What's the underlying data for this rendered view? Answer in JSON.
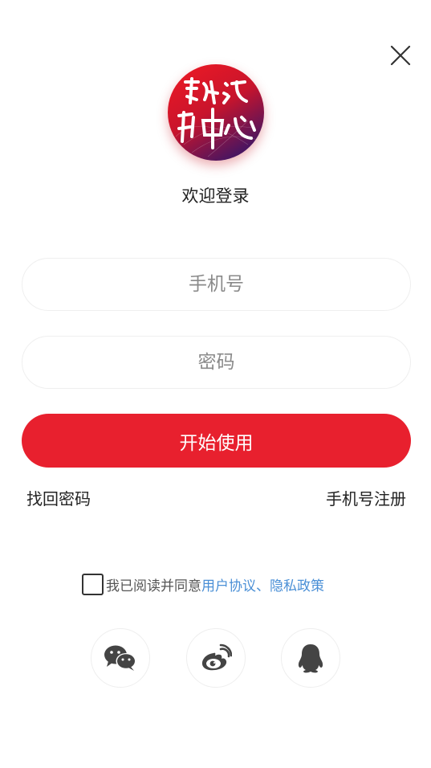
{
  "header": {
    "welcome_text": "欢迎登录"
  },
  "form": {
    "phone_placeholder": "手机号",
    "password_placeholder": "密码",
    "submit_label": "开始使用"
  },
  "links": {
    "forgot_password": "找回密码",
    "register": "手机号注册"
  },
  "agreement": {
    "checked": false,
    "prefix": "我已阅读并同意",
    "terms_link": "用户协议、隐私政策"
  },
  "social_login": [
    {
      "name": "wechat",
      "icon": "wechat-icon"
    },
    {
      "name": "weibo",
      "icon": "weibo-icon"
    },
    {
      "name": "qq",
      "icon": "qq-icon"
    }
  ],
  "colors": {
    "primary": "#e8202e",
    "link": "#4a8fd6",
    "icon_gray": "#444444"
  }
}
